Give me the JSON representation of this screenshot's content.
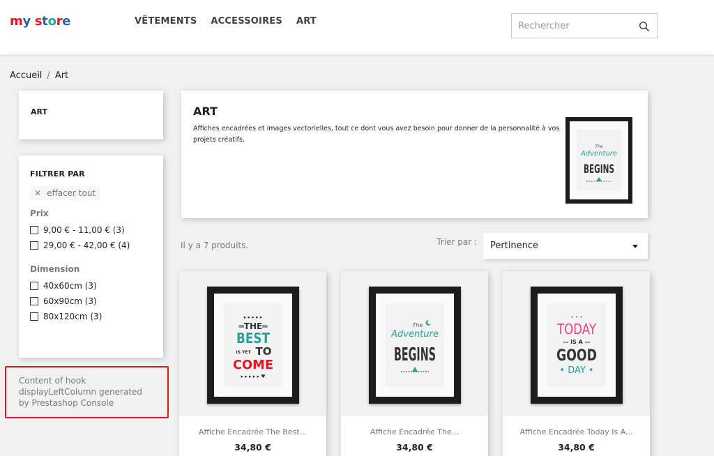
{
  "header": {
    "logo": [
      "m",
      "y",
      " ",
      "s",
      "t",
      "o",
      "r",
      "e"
    ],
    "logo_colors": [
      "#e8141c",
      "#2b5ea8",
      "#ffffff",
      "#e8141c",
      "#2b5ea8",
      "#26a69a",
      "#e8141c",
      "#2b5ea8"
    ],
    "nav": [
      "VÊTEMENTS",
      "ACCESSOIRES",
      "ART"
    ],
    "search_placeholder": "Rechercher"
  },
  "breadcrumb": [
    "Accueil",
    "Art"
  ],
  "left": {
    "category_title": "ART",
    "filter": {
      "title": "FILTRER PAR",
      "clear_all": "effacer tout",
      "price_title": "Prix",
      "price_options": [
        "9,00 € - 11,00 € (3)",
        "29,00 € - 42,00 € (4)"
      ],
      "dimension_title": "Dimension",
      "dimension_options": [
        "40x60cm (3)",
        "60x90cm (3)",
        "80x120cm (3)"
      ]
    },
    "hook_text": "Content of hook displayLeftColumn generated by Prestashop Console"
  },
  "category": {
    "title": "ART",
    "description": "Affiches encadrées et images vectorielles, tout ce dont vous avez besoin pour donner de la personnalité à vos projets créatifs."
  },
  "products_top": {
    "total": "Il y a 7 produits.",
    "sort_label": "Trier par :",
    "sort_value": "Pertinence"
  },
  "products": [
    {
      "name": "Affiche Encadrée The Best...",
      "price": "34,80 €",
      "art": "best"
    },
    {
      "name": "Affiche Encadrée The...",
      "price": "34,80 €",
      "art": "adventure"
    },
    {
      "name": "Affiche Encadrée Today Is A...",
      "price": "34,80 €",
      "art": "today"
    }
  ],
  "colors": {
    "accent_red": "#e8141c",
    "teal": "#2aa198",
    "pink": "#e8457a"
  }
}
